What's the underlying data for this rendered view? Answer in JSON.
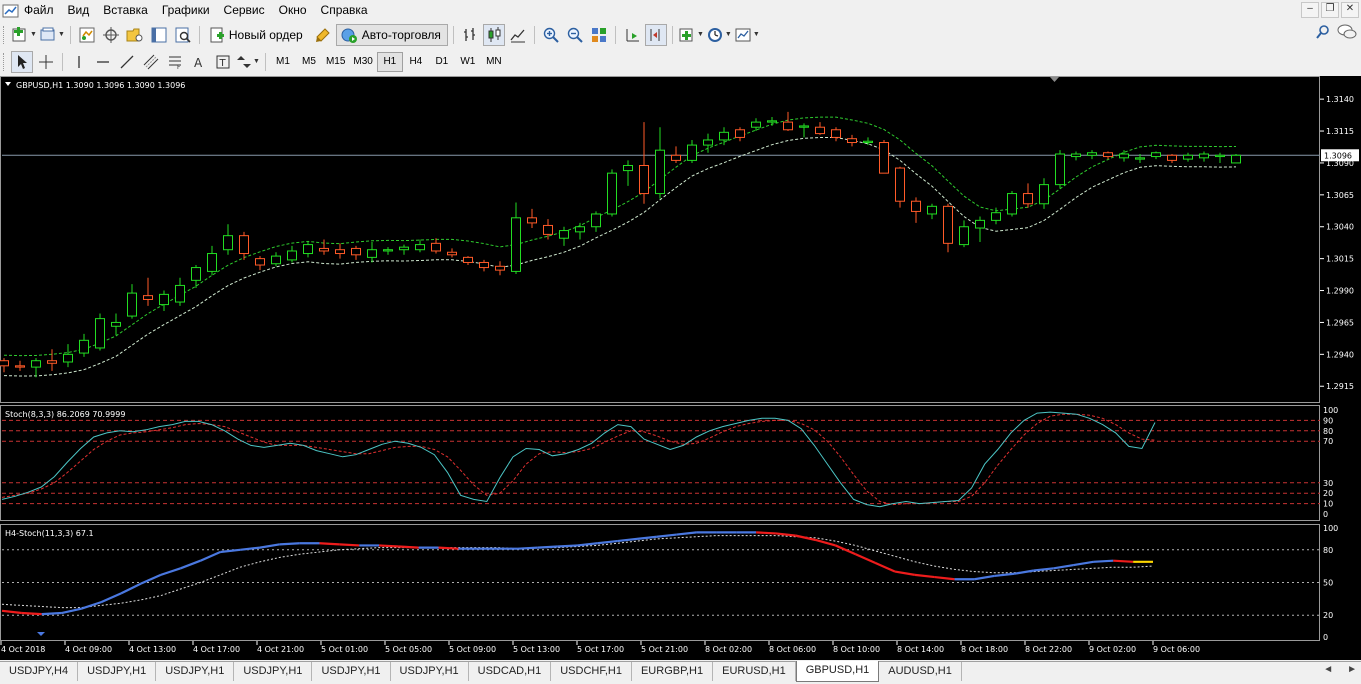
{
  "menu": {
    "items": [
      "Файл",
      "Вид",
      "Вставка",
      "Графики",
      "Сервис",
      "Окно",
      "Справка"
    ]
  },
  "toolbar1": {
    "new_order_label": "Новый ордер",
    "autotrading_label": "Авто-торговля"
  },
  "toolbar2": {
    "timeframes": [
      "M1",
      "M5",
      "M15",
      "M30",
      "H1",
      "H4",
      "D1",
      "W1",
      "MN"
    ],
    "active_timeframe": "H1"
  },
  "chart": {
    "header": "GBPUSD,H1  1.3090 1.3096 1.3090 1.3096",
    "current_price_label": "1.3096",
    "price_axis": [
      "1.3140",
      "1.3115",
      "1.3090",
      "1.3065",
      "1.3040",
      "1.3015",
      "1.2990",
      "1.2965",
      "1.2940",
      "1.2915"
    ],
    "time_axis": [
      "4 Oct 2018",
      "4 Oct 09:00",
      "4 Oct 13:00",
      "4 Oct 17:00",
      "4 Oct 21:00",
      "5 Oct 01:00",
      "5 Oct 05:00",
      "5 Oct 09:00",
      "5 Oct 13:00",
      "5 Oct 17:00",
      "5 Oct 21:00",
      "8 Oct 02:00",
      "8 Oct 06:00",
      "8 Oct 10:00",
      "8 Oct 14:00",
      "8 Oct 18:00",
      "8 Oct 22:00",
      "9 Oct 02:00",
      "9 Oct 06:00"
    ],
    "stoch_header": "Stoch(8,3,3) 86.2069 70.9999",
    "stoch_levels": [
      "100",
      "90",
      "80",
      "70",
      "30",
      "20",
      "10",
      "0"
    ],
    "h4_header": "H4-Stoch(11,3,3)  67.1",
    "h4_levels": [
      "100",
      "80",
      "50",
      "20",
      "0"
    ],
    "colors": {
      "background": "#000000",
      "bull_candle": "#22dd22",
      "bear_candle": "#ff5a28",
      "envelope": "#2ecc2e",
      "stoch_main": "#4cc6c6",
      "stoch_signal": "#e03030",
      "level_line": "#c83232",
      "h4_up": "#4a78e0",
      "h4_down": "#ee1c1c",
      "h4_flat": "#ffd700",
      "h4_signal": "#dddddd"
    }
  },
  "tabs": {
    "items": [
      "USDJPY,H4",
      "USDJPY,H1",
      "USDJPY,H1",
      "USDJPY,H1",
      "USDJPY,H1",
      "USDJPY,H1",
      "USDCAD,H1",
      "USDCHF,H1",
      "EURGBP,H1",
      "EURUSD,H1",
      "GBPUSD,H1",
      "AUDUSD,H1"
    ],
    "active_index": 10
  },
  "chart_data": {
    "type": "candlestick",
    "symbol": "GBPUSD",
    "timeframe": "H1",
    "ylim": [
      1.2905,
      1.3155
    ],
    "candles": [
      [
        1.2935,
        1.2937,
        1.2926,
        1.2931
      ],
      [
        1.2931,
        1.2935,
        1.2927,
        1.293
      ],
      [
        1.293,
        1.2937,
        1.2922,
        1.2935
      ],
      [
        1.2935,
        1.2944,
        1.2927,
        1.2933
      ],
      [
        1.2934,
        1.2948,
        1.293,
        1.294
      ],
      [
        1.2941,
        1.2956,
        1.2938,
        1.2951
      ],
      [
        1.2945,
        1.2972,
        1.2943,
        1.2968
      ],
      [
        1.2962,
        1.2972,
        1.2955,
        1.2965
      ],
      [
        1.297,
        1.2995,
        1.2968,
        1.2988
      ],
      [
        1.2986,
        1.3,
        1.2978,
        1.2983
      ],
      [
        1.2979,
        1.299,
        1.2974,
        1.2987
      ],
      [
        1.2981,
        1.3,
        1.2978,
        1.2994
      ],
      [
        1.2998,
        1.301,
        1.2992,
        1.3008
      ],
      [
        1.3005,
        1.3025,
        1.3002,
        1.3019
      ],
      [
        1.3022,
        1.3042,
        1.3018,
        1.3033
      ],
      [
        1.3033,
        1.3036,
        1.3014,
        1.3019
      ],
      [
        1.3015,
        1.3017,
        1.3006,
        1.301
      ],
      [
        1.3011,
        1.302,
        1.3009,
        1.3017
      ],
      [
        1.3014,
        1.3025,
        1.3012,
        1.3021
      ],
      [
        1.3019,
        1.3028,
        1.3016,
        1.3026
      ],
      [
        1.3023,
        1.303,
        1.3018,
        1.3021
      ],
      [
        1.3022,
        1.3027,
        1.3015,
        1.3019
      ],
      [
        1.3023,
        1.3025,
        1.3014,
        1.3018
      ],
      [
        1.3016,
        1.3028,
        1.3012,
        1.3022
      ],
      [
        1.3021,
        1.3024,
        1.3018,
        1.3022
      ],
      [
        1.3022,
        1.3026,
        1.3018,
        1.3024
      ],
      [
        1.3022,
        1.303,
        1.302,
        1.3026
      ],
      [
        1.3027,
        1.3031,
        1.3019,
        1.3021
      ],
      [
        1.302,
        1.3023,
        1.3016,
        1.3018
      ],
      [
        1.3016,
        1.3017,
        1.301,
        1.3012
      ],
      [
        1.3012,
        1.3014,
        1.3005,
        1.3008
      ],
      [
        1.3009,
        1.3013,
        1.3002,
        1.3006
      ],
      [
        1.3005,
        1.3059,
        1.3003,
        1.3047
      ],
      [
        1.3047,
        1.3054,
        1.3039,
        1.3043
      ],
      [
        1.3041,
        1.3046,
        1.303,
        1.3034
      ],
      [
        1.3031,
        1.304,
        1.3025,
        1.3037
      ],
      [
        1.3036,
        1.3043,
        1.303,
        1.304
      ],
      [
        1.304,
        1.3052,
        1.3036,
        1.305
      ],
      [
        1.305,
        1.3085,
        1.3048,
        1.3082
      ],
      [
        1.3084,
        1.3092,
        1.3072,
        1.3088
      ],
      [
        1.3088,
        1.3122,
        1.3058,
        1.3066
      ],
      [
        1.3066,
        1.3118,
        1.3062,
        1.31
      ],
      [
        1.3096,
        1.3103,
        1.309,
        1.3092
      ],
      [
        1.3092,
        1.3108,
        1.309,
        1.3104
      ],
      [
        1.3104,
        1.3113,
        1.3098,
        1.3108
      ],
      [
        1.3108,
        1.3118,
        1.3104,
        1.3114
      ],
      [
        1.3116,
        1.3118,
        1.3107,
        1.311
      ],
      [
        1.3118,
        1.3125,
        1.3115,
        1.3122
      ],
      [
        1.3122,
        1.3126,
        1.3119,
        1.3123
      ],
      [
        1.3122,
        1.313,
        1.3115,
        1.3116
      ],
      [
        1.3118,
        1.3121,
        1.311,
        1.3119
      ],
      [
        1.3118,
        1.3122,
        1.3112,
        1.3113
      ],
      [
        1.3116,
        1.3118,
        1.3107,
        1.311
      ],
      [
        1.3109,
        1.3112,
        1.3103,
        1.3106
      ],
      [
        1.3106,
        1.311,
        1.3104,
        1.3107
      ],
      [
        1.3106,
        1.3108,
        1.3084,
        1.3082
      ],
      [
        1.3086,
        1.3087,
        1.3055,
        1.306
      ],
      [
        1.306,
        1.3063,
        1.3043,
        1.3052
      ],
      [
        1.305,
        1.3058,
        1.3046,
        1.3056
      ],
      [
        1.3056,
        1.3058,
        1.302,
        1.3027
      ],
      [
        1.3026,
        1.3045,
        1.3024,
        1.304
      ],
      [
        1.3039,
        1.3048,
        1.3028,
        1.3045
      ],
      [
        1.3045,
        1.3055,
        1.3042,
        1.3051
      ],
      [
        1.305,
        1.3068,
        1.3048,
        1.3066
      ],
      [
        1.3066,
        1.3074,
        1.3055,
        1.3058
      ],
      [
        1.3058,
        1.3078,
        1.3054,
        1.3073
      ],
      [
        1.3073,
        1.31,
        1.307,
        1.3097
      ],
      [
        1.3095,
        1.3099,
        1.3092,
        1.3097
      ],
      [
        1.3096,
        1.31,
        1.3093,
        1.3098
      ],
      [
        1.3098,
        1.3099,
        1.3093,
        1.3095
      ],
      [
        1.3094,
        1.31,
        1.3091,
        1.3097
      ],
      [
        1.3093,
        1.3097,
        1.309,
        1.3094
      ],
      [
        1.3095,
        1.3099,
        1.3093,
        1.3098
      ],
      [
        1.3096,
        1.3097,
        1.309,
        1.3092
      ],
      [
        1.3093,
        1.3098,
        1.3091,
        1.3096
      ],
      [
        1.3094,
        1.3099,
        1.3091,
        1.3097
      ],
      [
        1.3095,
        1.3098,
        1.309,
        1.3096
      ],
      [
        1.309,
        1.3097,
        1.309,
        1.3096
      ]
    ],
    "stochastic": {
      "main": [
        14,
        17,
        21,
        26,
        36,
        50,
        63,
        74,
        78,
        80,
        79,
        81,
        84,
        86,
        89,
        89,
        86,
        80,
        72,
        66,
        64,
        66,
        68,
        66,
        61,
        58,
        55,
        57,
        62,
        67,
        70,
        68,
        64,
        57,
        40,
        18,
        14,
        12,
        35,
        55,
        63,
        62,
        56,
        58,
        62,
        68,
        78,
        86,
        84,
        72,
        67,
        62,
        66,
        74,
        80,
        84,
        87,
        90,
        92,
        92,
        90,
        82,
        66,
        48,
        30,
        14,
        9,
        7,
        10,
        12,
        10,
        11,
        12,
        13,
        25,
        48,
        62,
        78,
        90,
        97,
        98,
        97,
        96,
        92,
        86,
        78,
        65,
        63,
        88
      ],
      "signal": [
        16,
        18,
        20,
        24,
        30,
        40,
        51,
        62,
        70,
        76,
        78,
        79,
        81,
        83,
        86,
        87,
        86,
        84,
        79,
        74,
        69,
        66,
        66,
        66,
        64,
        62,
        60,
        58,
        58,
        61,
        64,
        65,
        65,
        62,
        55,
        42,
        28,
        18,
        20,
        32,
        48,
        58,
        60,
        59,
        60,
        63,
        69,
        75,
        80,
        79,
        75,
        70,
        67,
        68,
        73,
        79,
        84,
        87,
        89,
        90,
        90,
        87,
        81,
        70,
        55,
        38,
        22,
        12,
        9,
        10,
        10,
        11,
        12,
        12,
        17,
        30,
        47,
        62,
        76,
        87,
        94,
        96,
        96,
        95,
        92,
        86,
        78,
        72,
        71
      ]
    },
    "h4_stochastic": {
      "main": [
        24,
        22,
        21,
        22,
        26,
        32,
        40,
        49,
        57,
        63,
        70,
        78,
        80,
        82,
        85,
        86,
        86,
        85,
        84,
        84,
        83,
        82,
        82,
        81,
        81,
        81,
        81,
        82,
        83,
        84,
        86,
        88,
        90,
        92,
        94,
        96,
        96,
        96,
        96,
        95,
        93,
        89,
        84,
        76,
        68,
        60,
        57,
        55,
        53,
        53,
        56,
        58,
        61,
        63,
        66,
        69,
        70,
        69,
        69
      ],
      "signal": [
        30,
        29,
        28,
        27,
        27,
        29,
        31,
        34,
        38,
        44,
        50,
        57,
        64,
        69,
        73,
        76,
        78,
        80,
        81,
        82,
        82,
        82,
        82,
        82,
        82,
        82,
        81,
        82,
        82,
        83,
        84,
        86,
        88,
        90,
        91,
        92,
        93,
        93,
        93,
        93,
        92,
        91,
        88,
        84,
        79,
        74,
        69,
        65,
        62,
        60,
        59,
        59,
        60,
        61,
        62,
        63,
        64,
        64,
        65
      ]
    }
  }
}
